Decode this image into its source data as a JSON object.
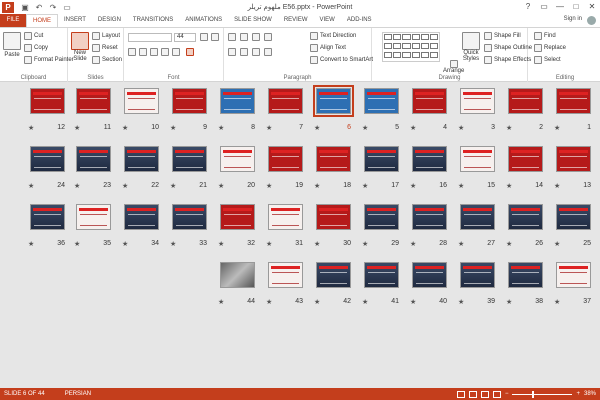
{
  "titlebar": {
    "app_icon": "P",
    "title": "E56.pptx - PowerPoint",
    "title_prefix": "ملهوم تريلر",
    "qat": [
      "save-icon",
      "undo-icon",
      "redo-icon",
      "present-icon"
    ],
    "controls": [
      "?",
      "▭",
      "—",
      "□",
      "✕"
    ]
  },
  "tabs": {
    "items": [
      "FILE",
      "HOME",
      "INSERT",
      "DESIGN",
      "TRANSITIONS",
      "ANIMATIONS",
      "SLIDE SHOW",
      "REVIEW",
      "VIEW",
      "ADD-INS"
    ],
    "active": "HOME",
    "sign_in": "Sign in"
  },
  "ribbon": {
    "clipboard": {
      "label": "Clipboard",
      "paste": "Paste",
      "cut": "Cut",
      "copy": "Copy",
      "format_painter": "Format Painter"
    },
    "slides": {
      "label": "Slides",
      "new_slide": "New",
      "new_slide2": "Slide",
      "layout": "Layout",
      "reset": "Reset",
      "section": "Section"
    },
    "font": {
      "label": "Font",
      "size": "44"
    },
    "paragraph": {
      "label": "Paragraph",
      "text_direction": "Text Direction",
      "align_text": "Align Text",
      "convert_smartart": "Convert to SmartArt"
    },
    "drawing": {
      "label": "Drawing",
      "arrange": "Arrange",
      "quick_styles": "Quick",
      "quick_styles2": "Styles",
      "shape_fill": "Shape Fill",
      "shape_outline": "Shape Outline",
      "shape_effects": "Shape Effects"
    },
    "editing": {
      "label": "Editing",
      "find": "Find",
      "replace": "Replace",
      "select": "Select"
    }
  },
  "sorter": {
    "selected": 6,
    "rows": [
      [
        12,
        11,
        10,
        9,
        8,
        7,
        6,
        5,
        4,
        3,
        2,
        1
      ],
      [
        24,
        23,
        22,
        21,
        20,
        19,
        18,
        17,
        16,
        15,
        14,
        13
      ],
      [
        36,
        35,
        34,
        33,
        32,
        31,
        30,
        29,
        28,
        27,
        26,
        25
      ],
      [
        44,
        43,
        42,
        41,
        40,
        39,
        38,
        37
      ]
    ],
    "star": "★"
  },
  "statusbar": {
    "slide_info": "SLIDE 6 OF 44",
    "language": "PERSIAN",
    "zoom": "38%"
  }
}
